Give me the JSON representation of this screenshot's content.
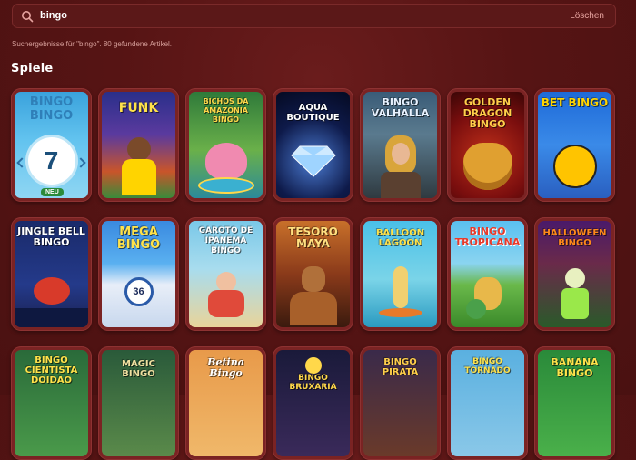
{
  "search": {
    "query": "bingo",
    "clear_label": "Löschen"
  },
  "results_text": "Suchergebnisse für \"bingo\". 80 gefundene Artikel.",
  "section_title": "Spiele",
  "badge_new": "NEU",
  "colors": {
    "background": "#561414",
    "card": "#7a2323",
    "accent": "#e6a39f"
  },
  "games": [
    {
      "title": "BINGO BINGO",
      "ball": "7"
    },
    {
      "title": "FUNK"
    },
    {
      "title": "BICHOS DA AMAZONIA BINGO"
    },
    {
      "title": "AQUA BOUTIQUE"
    },
    {
      "title": "BINGO VALHALLA"
    },
    {
      "title": "GOLDEN DRAGON BINGO"
    },
    {
      "title": "BET BINGO"
    },
    {
      "title": "JINGLE BELL BINGO"
    },
    {
      "title": "MEGA BINGO",
      "ball": "36"
    },
    {
      "title": "GAROTO DE IPANEMA BINGO"
    },
    {
      "title": "TESORO MAYA"
    },
    {
      "title": "BALLOON LAGOON"
    },
    {
      "title": "BINGO TROPICANA"
    },
    {
      "title": "HALLOWEEN BINGO"
    },
    {
      "title": "BINGO CIENTISTA DOIDAO"
    },
    {
      "title": "MAGIC BINGO"
    },
    {
      "title": "Betina Bingo"
    },
    {
      "title": "BINGO BRUXARIA"
    },
    {
      "title": "BINGO PIRATA"
    },
    {
      "title": "BINGO TORNADO"
    },
    {
      "title": "BANANA BINGO"
    }
  ]
}
